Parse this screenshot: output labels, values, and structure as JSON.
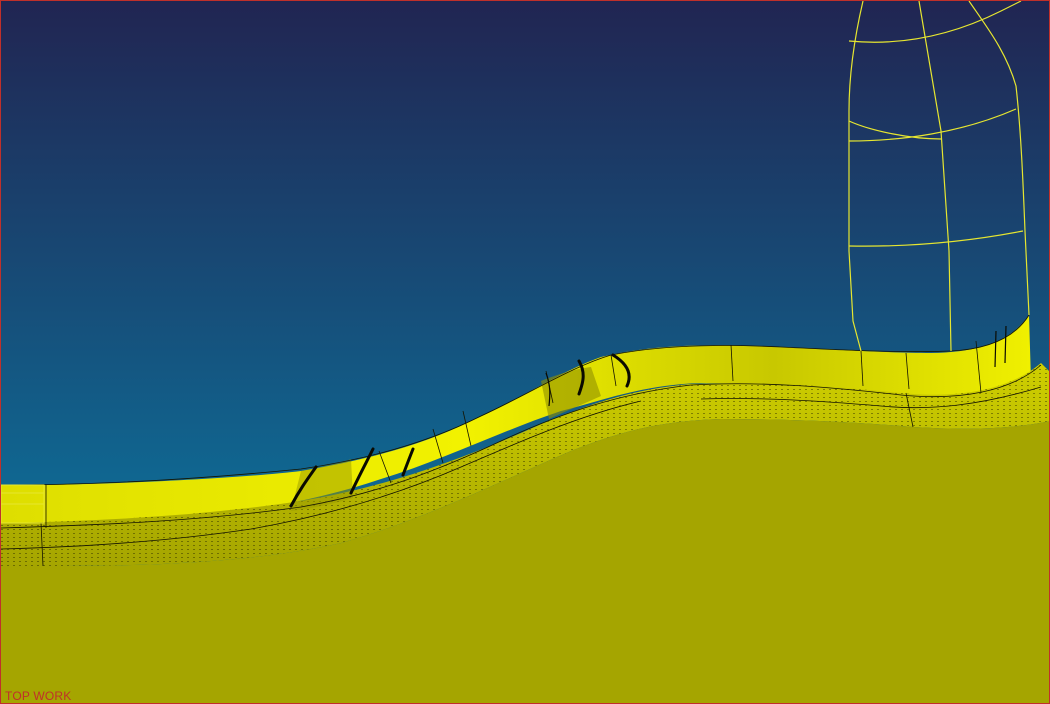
{
  "viewport": {
    "view_label": "TOP WORK",
    "background_top_color": "#212552",
    "background_bottom_color": "#0e6d97",
    "border_color": "#c0302a"
  },
  "model": {
    "part_surface_color": "#a5a500",
    "wall_face_color": "#e9e900",
    "wall_shadow_color": "#7a7a00",
    "wireframe_color": "#e6e630",
    "edge_color": "#141400"
  },
  "tool": {
    "icon": "cutter-tool-wireframe-icon"
  }
}
